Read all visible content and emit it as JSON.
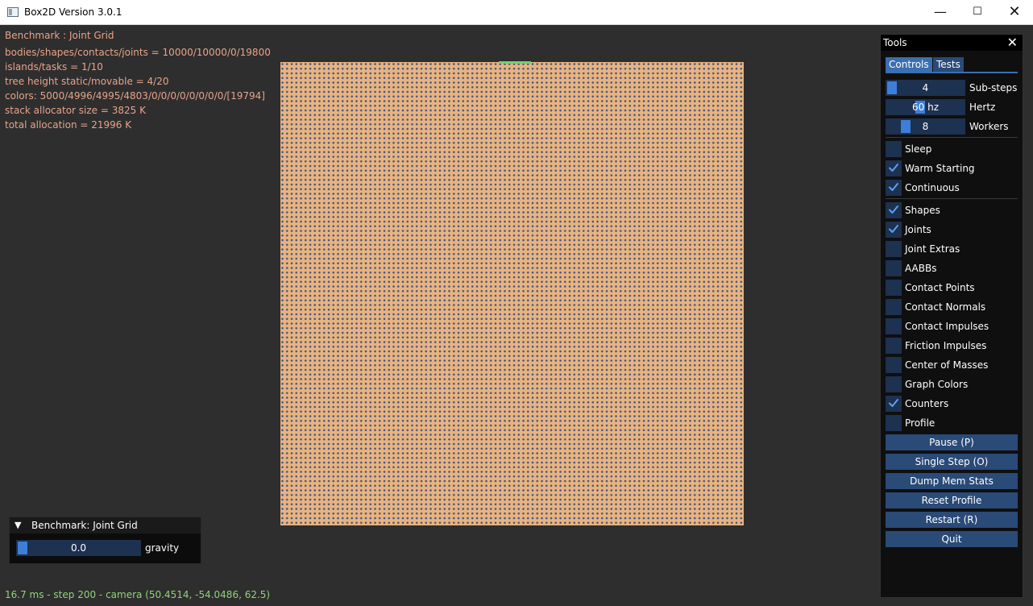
{
  "window": {
    "title": "Box2D Version 3.0.1",
    "minimize_glyph": "—",
    "maximize_glyph": "☐",
    "close_glyph": "✕"
  },
  "stats": [
    "Benchmark : Joint Grid",
    "bodies/shapes/contacts/joints = 10000/10000/0/19800",
    "islands/tasks = 1/10",
    "tree height static/movable = 4/20",
    "colors: 5000/4996/4995/4803/0/0/0/0/0/0/0/0/[19794]",
    "stack allocator size = 3825 K",
    "total allocation = 21996 K"
  ],
  "benchmark_panel": {
    "collapse_glyph": "▼",
    "title": "Benchmark: Joint Grid",
    "gravity_value": "0.0",
    "gravity_label": "gravity",
    "gravity_fraction": 0.0
  },
  "status_line": "16.7 ms - step 200 - camera (50.4514, -54.0486, 62.5)",
  "tools": {
    "title": "Tools",
    "close_glyph": "✕",
    "tabs": [
      "Controls",
      "Tests"
    ],
    "sliders": [
      {
        "value": "4",
        "label": "Sub-steps",
        "fraction": 0.0
      },
      {
        "value": "60 hz",
        "label": "Hertz",
        "fraction": 0.42
      },
      {
        "value": "8",
        "label": "Workers",
        "fraction": 0.2
      }
    ],
    "checkboxes_group1": [
      {
        "label": "Sleep",
        "checked": false
      },
      {
        "label": "Warm Starting",
        "checked": true
      },
      {
        "label": "Continuous",
        "checked": true
      }
    ],
    "checkboxes_group2": [
      {
        "label": "Shapes",
        "checked": true
      },
      {
        "label": "Joints",
        "checked": true
      },
      {
        "label": "Joint Extras",
        "checked": false
      },
      {
        "label": "AABBs",
        "checked": false
      },
      {
        "label": "Contact Points",
        "checked": false
      },
      {
        "label": "Contact Normals",
        "checked": false
      },
      {
        "label": "Contact Impulses",
        "checked": false
      },
      {
        "label": "Friction Impulses",
        "checked": false
      },
      {
        "label": "Center of Masses",
        "checked": false
      },
      {
        "label": "Graph Colors",
        "checked": false
      },
      {
        "label": "Counters",
        "checked": true
      },
      {
        "label": "Profile",
        "checked": false
      }
    ],
    "buttons": [
      "Pause (P)",
      "Single Step (O)",
      "Dump Mem Stats",
      "Reset Profile",
      "Restart (R)",
      "Quit"
    ]
  },
  "colors": {
    "stat_text": "#e6a38a",
    "status_text": "#8fd37a",
    "grid_fill": "#e9b47c",
    "grid_dots": "#3e5396",
    "accent": "#3d7ed8",
    "widget_bg": "#1d3150",
    "button_bg": "#2a4a78"
  }
}
